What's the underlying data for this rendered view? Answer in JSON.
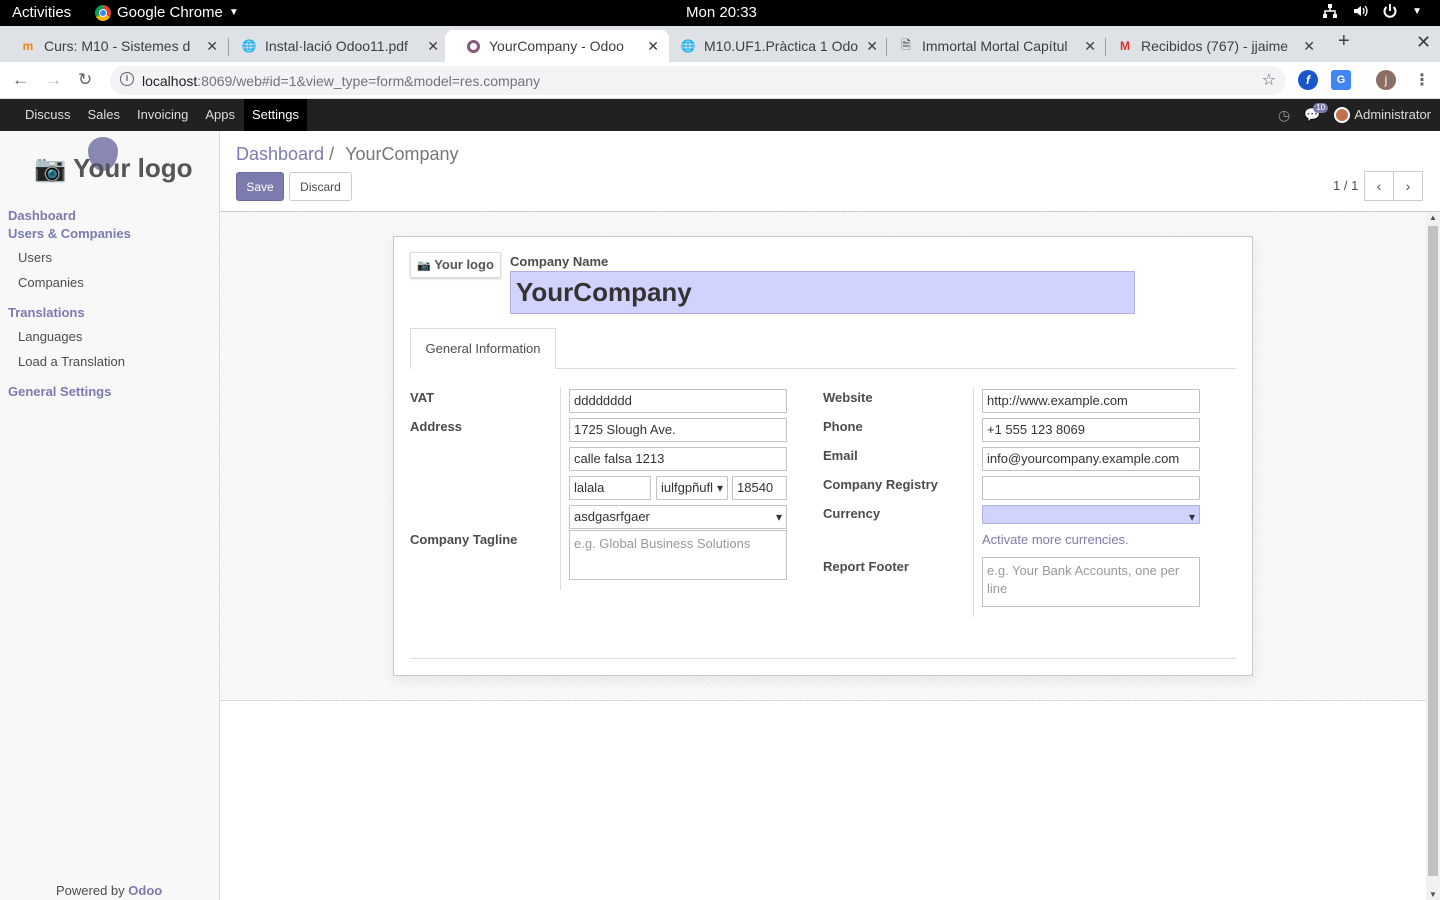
{
  "os_bar": {
    "activities": "Activities",
    "app_name": "Google Chrome",
    "clock": "Mon 20:33"
  },
  "tabs": [
    {
      "title": "Curs: M10 - Sistemes d",
      "icon": "moodle-icon"
    },
    {
      "title": "Instal·lació Odoo11.pdf",
      "icon": "globe-icon"
    },
    {
      "title": "YourCompany - Odoo",
      "icon": "odoo-icon",
      "active": true
    },
    {
      "title": "M10.UF1.Pràctica 1 Odo",
      "icon": "globe-icon"
    },
    {
      "title": "Immortal Mortal Capítul",
      "icon": "document-icon"
    },
    {
      "title": "Recibidos (767) - jjaime",
      "icon": "gmail-icon"
    }
  ],
  "browser": {
    "url_host": "localhost",
    "url_rest": ":8069/web#id=1&view_type=form&model=res.company",
    "profile_initial": "j"
  },
  "odoo_nav": {
    "menu": [
      "Discuss",
      "Sales",
      "Invoicing",
      "Apps",
      "Settings"
    ],
    "active": "Settings",
    "chat_count": "10",
    "user": "Administrator"
  },
  "sidebar": {
    "logo_text": "Your logo",
    "dashboard": "Dashboard",
    "users_companies": "Users & Companies",
    "users": "Users",
    "companies": "Companies",
    "translations": "Translations",
    "languages": "Languages",
    "load_translation": "Load a Translation",
    "general_settings": "General Settings",
    "powered_by": "Powered by",
    "powered_brand": "Odoo"
  },
  "control_panel": {
    "breadcrumb_parent": "Dashboard",
    "breadcrumb_sep": "/",
    "breadcrumb_current": "YourCompany",
    "save": "Save",
    "discard": "Discard",
    "pager": "1 / 1"
  },
  "form": {
    "logo_button": "Your logo",
    "company_name_label": "Company Name",
    "company_name": "YourCompany",
    "tab_general": "General Information",
    "vat_label": "VAT",
    "vat": "dddddddd",
    "address_label": "Address",
    "street": "1725 Slough Ave.",
    "street2": "calle falsa 1213",
    "city": "lalala",
    "state": "iulfgpñufl",
    "zip": "18540",
    "country": "asdgasrfgaer",
    "tagline_label": "Company Tagline",
    "tagline_placeholder": "e.g. Global Business Solutions",
    "website_label": "Website",
    "website": "http://www.example.com",
    "phone_label": "Phone",
    "phone": "+1 555 123 8069",
    "email_label": "Email",
    "email": "info@yourcompany.example.com",
    "registry_label": "Company Registry",
    "registry": "",
    "currency_label": "Currency",
    "currency": "",
    "activate_currencies": "Activate more currencies.",
    "report_footer_label": "Report Footer",
    "report_footer_placeholder": "e.g. Your Bank Accounts, one per line"
  },
  "colors": {
    "brand": "#7c7bad",
    "navbar": "#212121",
    "required_field": "#d2d2ff"
  }
}
